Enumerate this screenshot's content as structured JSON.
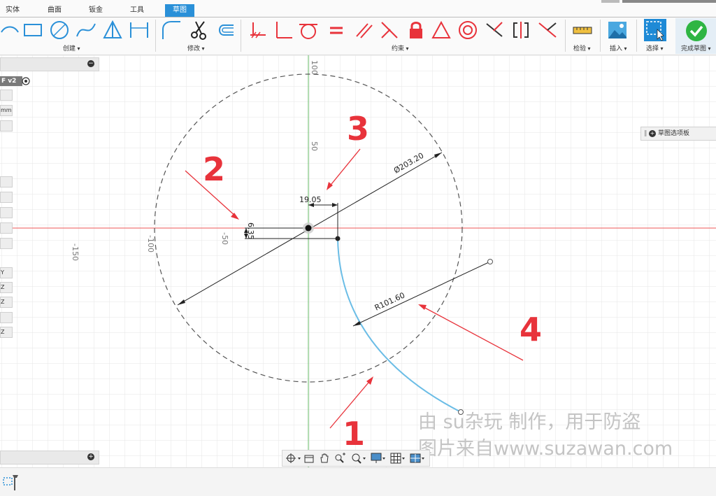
{
  "tabs": [
    "实体",
    "曲面",
    "钣金",
    "工具",
    "草图"
  ],
  "toolbar_groups": {
    "create": "创建",
    "modify": "修改",
    "constraints": "约束",
    "inspect": "检验",
    "insert": "插入",
    "select": "选择",
    "finish": "完成草图"
  },
  "left_panel": {
    "sketch_label": "F v2",
    "unit": "mm",
    "axis_labels": [
      "Y",
      "Z",
      "Z",
      "Z"
    ]
  },
  "sketch_palette_label": "草图选项板",
  "axis_ticks": {
    "x": [
      "-150",
      "-100",
      "-50"
    ],
    "y": [
      "100",
      "50"
    ]
  },
  "dimensions": {
    "diameter": "Ø203.20",
    "radius": "R101.60",
    "horizontal": "19.05",
    "vertical": "6.35"
  },
  "annotations": [
    "1",
    "2",
    "3",
    "4"
  ],
  "watermark": {
    "line1": "由 su杂玩 制作，用于防盗",
    "line2": "图片来自www.suzawan.com"
  },
  "colors": {
    "accent": "#2a90d8",
    "arc": "#6bbde6",
    "arrow": "#e8333b",
    "axis_x": "#ee5555",
    "axis_y": "#66bb66",
    "grid": "#e6e6e6"
  }
}
